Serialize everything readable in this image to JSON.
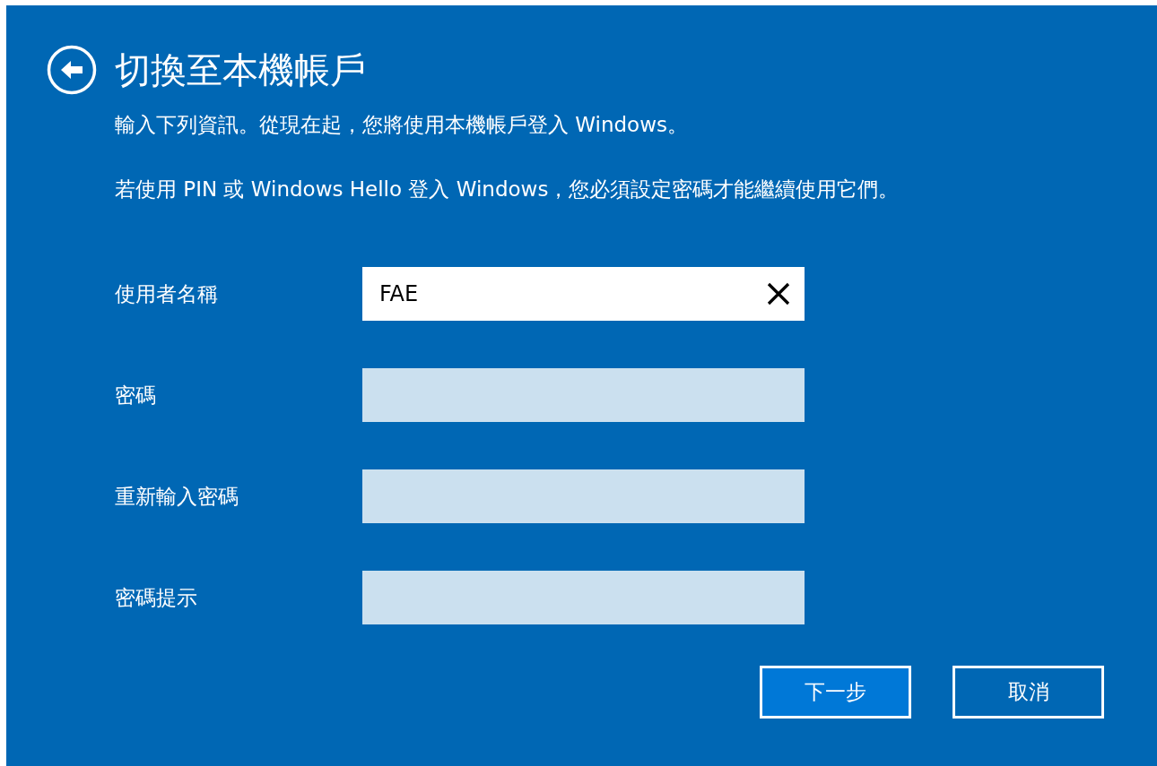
{
  "title": "切換至本機帳戶",
  "paragraphs": [
    "輸入下列資訊。從現在起，您將使用本機帳戶登入 Windows。",
    "若使用 PIN 或 Windows Hello 登入 Windows，您必須設定密碼才能繼續使用它們。"
  ],
  "fields": [
    {
      "label": "使用者名稱",
      "value": "FAE",
      "focused": true
    },
    {
      "label": "密碼",
      "focused": false
    },
    {
      "label": "重新輸入密碼",
      "focused": false
    },
    {
      "label": "密碼提示",
      "focused": false
    }
  ],
  "buttons": [
    {
      "label": "下一步",
      "default": true
    },
    {
      "label": "取消",
      "default": false
    }
  ]
}
